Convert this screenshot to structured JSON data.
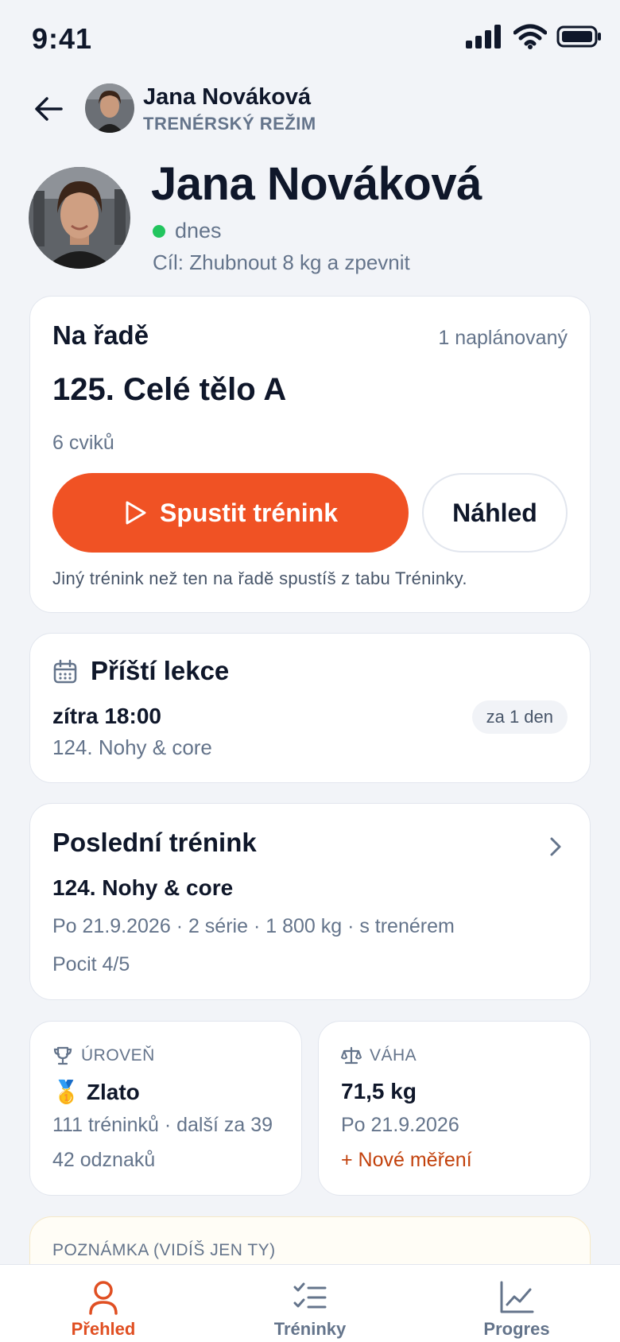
{
  "status_bar": {
    "time": "9:41"
  },
  "header": {
    "name": "Jana Nováková",
    "mode": "TRENÉRSKÝ REŽIM"
  },
  "profile": {
    "name": "Jana Nováková",
    "online": "dnes",
    "goal": "Cíl: Zhubnout 8 kg a zpevnit"
  },
  "next_card": {
    "title": "Na řadě",
    "count": "1 naplánovaný",
    "workout": "125. Celé tělo A",
    "exercises": "6 cviků",
    "start_label": "Spustit trénink",
    "preview_label": "Náhled",
    "hint": "Jiný trénink než ten na řadě spustíš z tabu Tréninky."
  },
  "lesson_card": {
    "title": "Příští lekce",
    "when": "zítra 18:00",
    "workout": "124. Nohy & core",
    "badge": "za 1 den"
  },
  "last_card": {
    "title": "Poslední trénink",
    "workout": "124. Nohy & core",
    "meta": "Po 21.9.2026 · 2 série · 1 800 kg · s trenérem",
    "feel": "Pocit 4/5"
  },
  "level_card": {
    "label": "ÚROVEŇ",
    "medal": "🥇",
    "value": "Zlato",
    "line1": "111 tréninků · další za 39",
    "line2": "42 odznaků"
  },
  "weight_card": {
    "label": "VÁHA",
    "value": "71,5 kg",
    "line1": "Po 21.9.2026",
    "link": "+ Nové měření"
  },
  "note_card": {
    "label": "POZNÁMKA (VIDÍŠ JEN TY)"
  },
  "tabs": [
    {
      "label": "Přehled",
      "icon": "user-icon"
    },
    {
      "label": "Tréninky",
      "icon": "checklist-icon"
    },
    {
      "label": "Progres",
      "icon": "chart-icon"
    }
  ],
  "colors": {
    "accent": "#f05224",
    "online": "#22c55e",
    "link": "#c2410c"
  }
}
